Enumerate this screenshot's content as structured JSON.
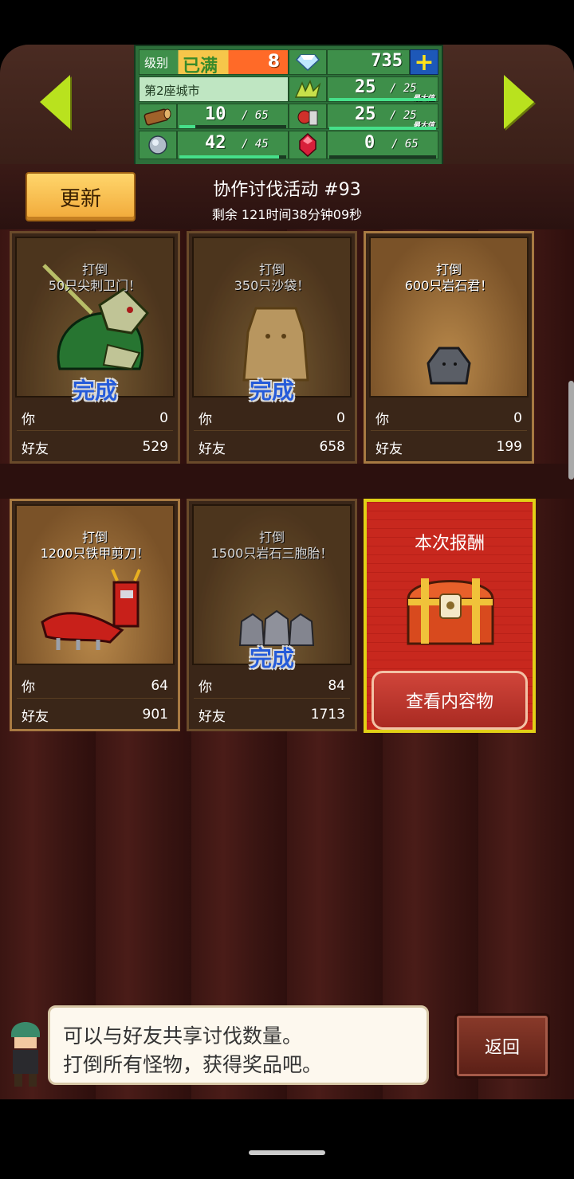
{
  "stats": {
    "level_label": "级别",
    "level_status": "已满",
    "level_value": "8",
    "gems": "735",
    "plus_icon": "+",
    "city_name": "第2座城市",
    "wood_cur": "10",
    "wood_max": "/ 65",
    "ore_cur": "42",
    "ore_max": "/ 45",
    "grass_cur": "25",
    "grass_max": "/ 25",
    "grass_max_label": "最大值",
    "food_cur": "25",
    "food_max": "/ 25",
    "food_max_label": "最大值",
    "ruby_cur": "0",
    "ruby_max": "/ 65",
    "progress": {
      "wood": 0.15,
      "ore": 0.93,
      "grass": 1.0,
      "food": 1.0,
      "ruby": 0.0
    }
  },
  "header": {
    "refresh_label": "更新",
    "event_title": "协作讨伐活动 #93",
    "time_left": "剩余 121时间38分钟09秒"
  },
  "cards": [
    {
      "line1": "打倒",
      "line2": "50只尖刺卫门！",
      "complete": "完成",
      "you_label": "你",
      "you_value": "0",
      "friend_label": "好友",
      "friend_value": "529"
    },
    {
      "line1": "打倒",
      "line2": "350只沙袋！",
      "complete": "完成",
      "you_label": "你",
      "you_value": "0",
      "friend_label": "好友",
      "friend_value": "658"
    },
    {
      "line1": "打倒",
      "line2": "600只岩石君！",
      "complete": "",
      "you_label": "你",
      "you_value": "0",
      "friend_label": "好友",
      "friend_value": "199"
    },
    {
      "line1": "打倒",
      "line2": "1200只铁甲剪刀！",
      "complete": "",
      "you_label": "你",
      "you_value": "64",
      "friend_label": "好友",
      "friend_value": "901"
    },
    {
      "line1": "打倒",
      "line2": "1500只岩石三胞胎！",
      "complete": "完成",
      "you_label": "你",
      "you_value": "84",
      "friend_label": "好友",
      "friend_value": "1713"
    }
  ],
  "reward": {
    "title": "本次报酬",
    "button_label": "查看内容物"
  },
  "dialog": {
    "line1": "可以与好友共享讨伐数量。",
    "line2": "打倒所有怪物，获得奖品吧。"
  },
  "back_label": "返回",
  "icons": {
    "arrow_left": "arrow-left-icon",
    "arrow_right": "arrow-right-icon",
    "diamond": "diamond-icon",
    "wood": "wood-log-icon",
    "ore": "silver-ore-icon",
    "grass": "grass-icon",
    "food": "food-icon",
    "ruby": "ruby-icon",
    "chest": "treasure-chest-icon"
  },
  "colors": {
    "accent_green": "#b9e21e",
    "complete_blue": "#2b6bff",
    "reward_red": "#c8281e",
    "reward_border": "#e2d016"
  }
}
